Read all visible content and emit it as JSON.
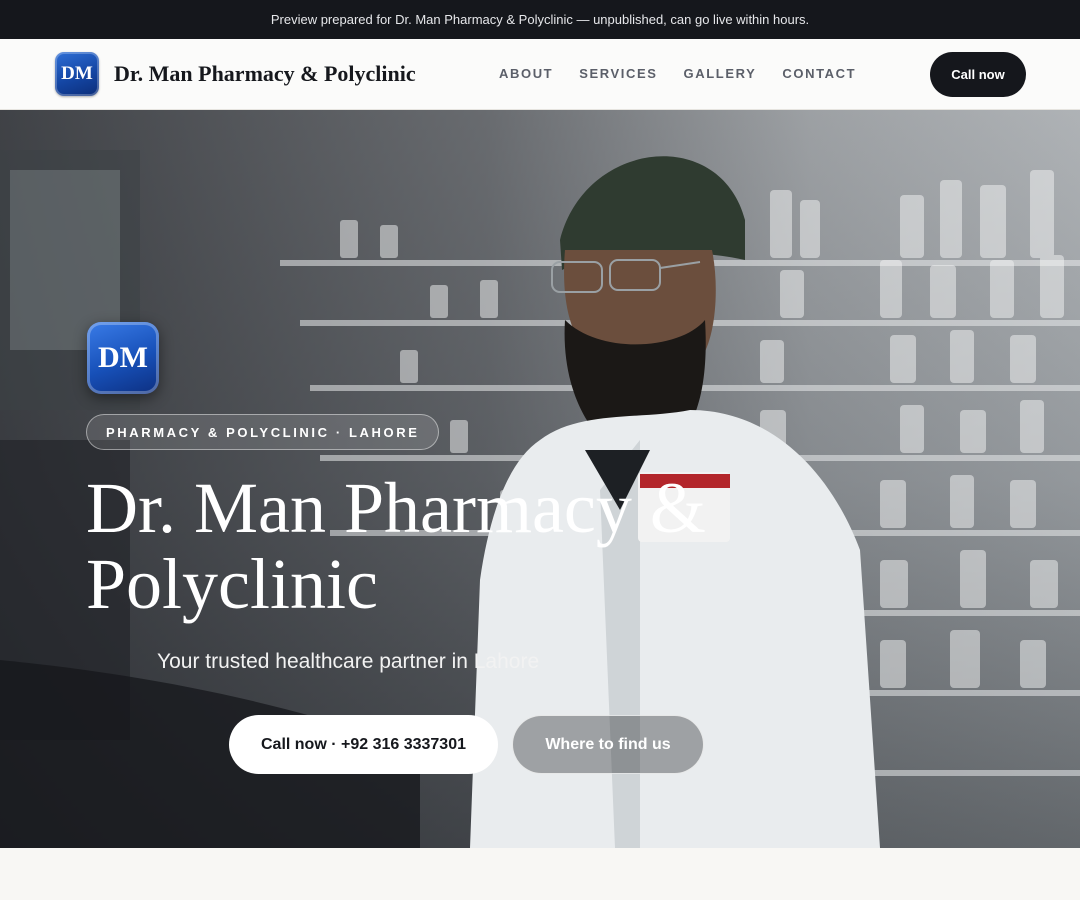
{
  "banner": {
    "text": "Preview prepared for Dr. Man Pharmacy & Polyclinic — unpublished, can go live within hours."
  },
  "nav": {
    "logo_text": "DM",
    "brand_name": "Dr. Man Pharmacy & Polyclinic",
    "links": [
      {
        "label": "ABOUT"
      },
      {
        "label": "SERVICES"
      },
      {
        "label": "GALLERY"
      },
      {
        "label": "CONTACT"
      }
    ],
    "cta_label": "Call now"
  },
  "hero": {
    "logo_text": "DM",
    "eyebrow": "PHARMACY & POLYCLINIC · LAHORE",
    "title": "Dr. Man Pharmacy & Polyclinic",
    "subtitle": "Your trusted healthcare partner in Lahore",
    "primary_cta": "Call now · +92 316 3337301",
    "secondary_cta": "Where to find us"
  },
  "colors": {
    "banner_bg": "#15171c",
    "logo_blue": "#1750b8",
    "cta_dark": "#15171c",
    "page_bg": "#f8f7f4"
  }
}
